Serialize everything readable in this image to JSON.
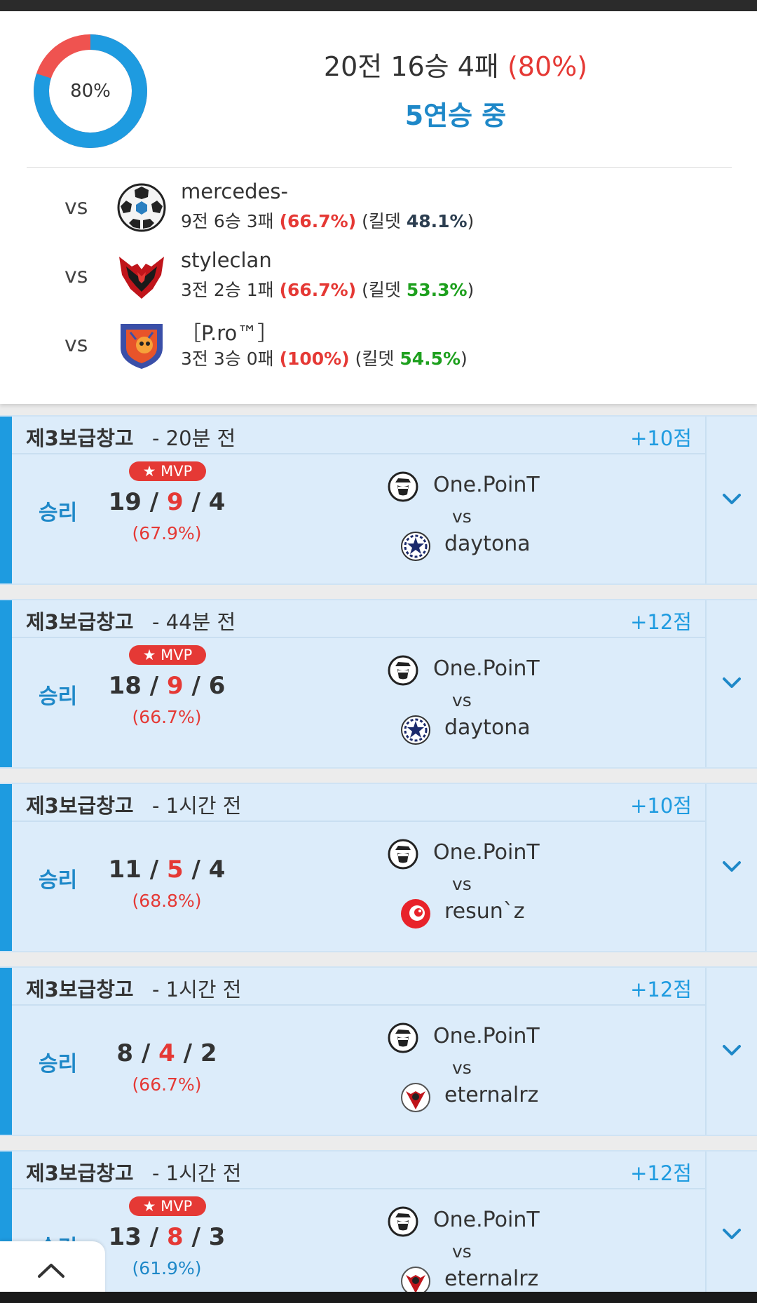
{
  "summary": {
    "win_rate_label": "80%",
    "win_rate": 0.8,
    "record_text": "20전 16승 4패 ",
    "record_pct": "(80%)",
    "streak": "5연승 중",
    "colors": {
      "win": "#1e9be0",
      "loss": "#ef5350"
    }
  },
  "opponents": [
    {
      "vs": "vs",
      "logo": "soccer-ball-logo-icon",
      "name": "mercedes-",
      "record": "9전 6승 3패 ",
      "pct": "(66.7%)",
      "kd_label": " (킬뎃 ",
      "kd": "48.1%",
      "kd_close": ")"
    },
    {
      "vs": "vs",
      "logo": "red-eagle-logo-icon",
      "name": "styleclan",
      "record": "3전 2승 1패 ",
      "pct": "(66.7%)",
      "kd_label": " (킬뎃 ",
      "kd": "53.3%",
      "kd_close": ")"
    },
    {
      "vs": "vs",
      "logo": "flame-mascot-logo-icon",
      "name": "［P.ro™］",
      "record": "3전 3승 0패 ",
      "pct": "(100%)",
      "kd_label": " (킬뎃 ",
      "kd": "54.5%",
      "kd_close": ")"
    }
  ],
  "matches": [
    {
      "map": "제3보급창고",
      "time": "-  20분 전",
      "points": "+10점",
      "result": "승리",
      "mvp": "★ MVP",
      "kills": "19",
      "deaths": "9",
      "assists": "4",
      "kda_pct": "(67.9%)",
      "team1": "One.PoinT",
      "vs": "vs",
      "team2": "daytona"
    },
    {
      "map": "제3보급창고",
      "time": "-  44분 전",
      "points": "+12점",
      "result": "승리",
      "mvp": "★ MVP",
      "kills": "18",
      "deaths": "9",
      "assists": "6",
      "kda_pct": "(66.7%)",
      "team1": "One.PoinT",
      "vs": "vs",
      "team2": "daytona"
    },
    {
      "map": "제3보급창고",
      "time": "-  1시간 전",
      "points": "+10점",
      "result": "승리",
      "mvp": "",
      "kills": "11",
      "deaths": "5",
      "assists": "4",
      "kda_pct": "(68.8%)",
      "team1": "One.PoinT",
      "vs": "vs",
      "team2": "resun`z"
    },
    {
      "map": "제3보급창고",
      "time": "-  1시간 전",
      "points": "+12점",
      "result": "승리",
      "mvp": "",
      "kills": "8",
      "deaths": "4",
      "assists": "2",
      "kda_pct": "(66.7%)",
      "team1": "One.PoinT",
      "vs": "vs",
      "team2": "eternalrz"
    },
    {
      "map": "제3보급창고",
      "time": "-  1시간 전",
      "points": "+12점",
      "result": "승리",
      "mvp": "★ MVP",
      "kills": "13",
      "deaths": "8",
      "assists": "3",
      "kda_pct": "(61.9%)",
      "team1": "One.PoinT",
      "vs": "vs",
      "team2": "eternalrz"
    }
  ]
}
